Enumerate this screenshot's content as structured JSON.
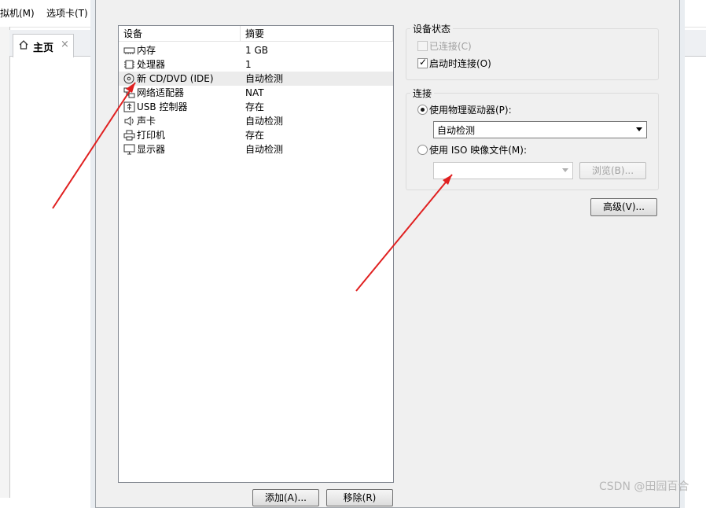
{
  "app": {
    "menu": [
      "拟机(M)",
      "选项卡(T)"
    ],
    "home_tab": {
      "label": "主页",
      "close": "×"
    }
  },
  "device_list": {
    "headers": [
      "设备",
      "摘要"
    ],
    "rows": [
      {
        "name": "内存",
        "summary": "1 GB",
        "icon": "memory-icon"
      },
      {
        "name": "处理器",
        "summary": "1",
        "icon": "cpu-icon"
      },
      {
        "name": "新 CD/DVD (IDE)",
        "summary": "自动检测",
        "icon": "cd-icon",
        "selected": true
      },
      {
        "name": "网络适配器",
        "summary": "NAT",
        "icon": "network-icon"
      },
      {
        "name": "USB 控制器",
        "summary": "存在",
        "icon": "usb-icon"
      },
      {
        "name": "声卡",
        "summary": "自动检测",
        "icon": "sound-icon"
      },
      {
        "name": "打印机",
        "summary": "存在",
        "icon": "printer-icon"
      },
      {
        "name": "显示器",
        "summary": "自动检测",
        "icon": "display-icon"
      }
    ],
    "add_button": "添加(A)...",
    "remove_button": "移除(R)"
  },
  "device_status": {
    "title": "设备状态",
    "connected": {
      "label": "已连接(C)",
      "checked": false,
      "enabled": false
    },
    "connect_on_start": {
      "label": "启动时连接(O)",
      "checked": true,
      "enabled": true
    }
  },
  "connection": {
    "title": "连接",
    "physical": {
      "label": "使用物理驱动器(P):",
      "selected": true
    },
    "physical_select_value": "自动检测",
    "iso": {
      "label": "使用 ISO 映像文件(M):",
      "selected": false
    },
    "iso_placeholder": "",
    "browse_button": "浏览(B)..."
  },
  "advanced_button": "高级(V)...",
  "watermark": "CSDN @田园百合",
  "colors": {
    "annotation_arrow": "#e02020",
    "selection": "#ececec"
  }
}
